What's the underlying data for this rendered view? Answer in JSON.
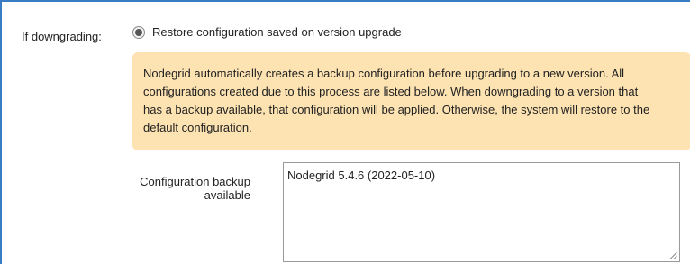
{
  "downgrade": {
    "label": "If downgrading:",
    "option_label": "Restore configuration saved on version upgrade",
    "option_selected": true
  },
  "info": {
    "lines": [
      "Nodegrid automatically creates a backup configuration before upgrading to a new version. All",
      "configurations created due to this process are listed below. When downgrading to a version that",
      "has a backup available, that configuration will be applied. Otherwise, the system will restore to the",
      "default configuration."
    ],
    "background_color": "#fde3b2"
  },
  "backup": {
    "label_line1": "Configuration backup",
    "label_line2": "available",
    "options": [
      "Nodegrid 5.4.6 (2022-05-10)"
    ]
  },
  "colors": {
    "panel_border": "#3a7cc4"
  }
}
